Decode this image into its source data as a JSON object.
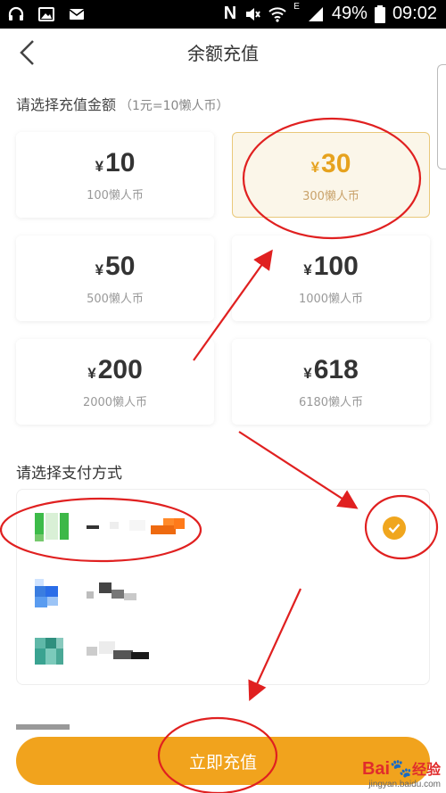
{
  "status_bar": {
    "battery": "49%",
    "time": "09:02",
    "network_letter": "N",
    "signal_letter": "E"
  },
  "header": {
    "title": "余额充值",
    "back_icon": "chevron-left-icon"
  },
  "amount_section": {
    "label": "请选择充值金额",
    "hint": "（1元=10懒人币）",
    "options": [
      {
        "currency": "¥",
        "value": "10",
        "coins": "100懒人币",
        "selected": false
      },
      {
        "currency": "¥",
        "value": "30",
        "coins": "300懒人币",
        "selected": true
      },
      {
        "currency": "¥",
        "value": "50",
        "coins": "500懒人币",
        "selected": false
      },
      {
        "currency": "¥",
        "value": "100",
        "coins": "1000懒人币",
        "selected": false
      },
      {
        "currency": "¥",
        "value": "200",
        "coins": "2000懒人币",
        "selected": false
      },
      {
        "currency": "¥",
        "value": "618",
        "coins": "6180懒人币",
        "selected": false
      }
    ]
  },
  "payment_section": {
    "label": "请选择支付方式",
    "methods": [
      {
        "icon": "wechat-pay-icon-pixelated",
        "selected": true
      },
      {
        "icon": "alipay-icon-pixelated",
        "selected": false
      },
      {
        "icon": "other-pay-icon-pixelated",
        "selected": false
      }
    ]
  },
  "pay_button": {
    "label": "立即充值"
  },
  "watermark": {
    "logo_left": "Bai",
    "logo_right": "经验",
    "url": "jingyan.baidu.com"
  },
  "colors": {
    "accent": "#f1a31d",
    "selected_bg": "#fbf6e9",
    "annotation_red": "#e02020"
  }
}
